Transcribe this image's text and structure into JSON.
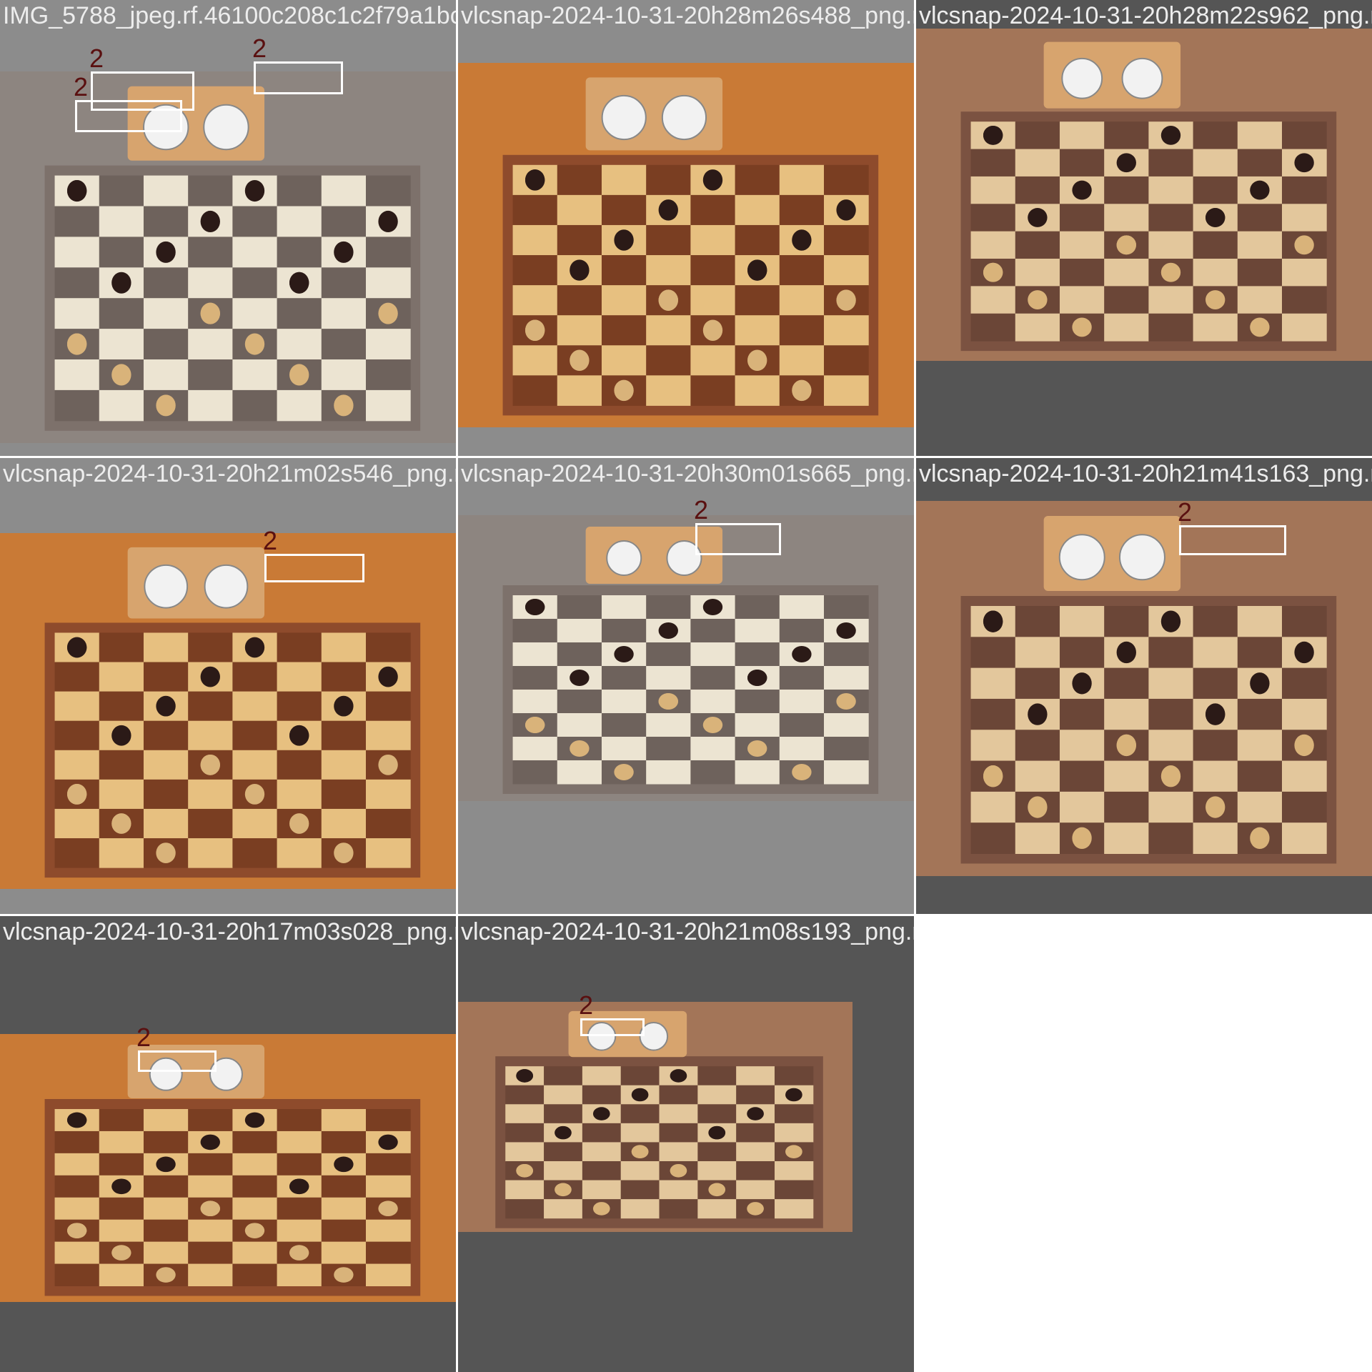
{
  "colors": {
    "background": "#ffffff",
    "pad_light": "#8c8c8c",
    "pad_dark": "#555555",
    "caption": "#ededed",
    "bbox": "#ffffff",
    "bbox_label": "#5a1010"
  },
  "tiles": [
    {
      "filename": "IMG_5788_jpeg.rf.46100c208c1c2f79a1bcdd83",
      "label": "2",
      "pad": "light",
      "theme": "grey-wood",
      "icon": "chessboard-clock-photo"
    },
    {
      "filename": "vlcsnap-2024-10-31-20h28m26s488_png.rf.b",
      "label": "2",
      "pad": "light",
      "theme": "orange-wood",
      "icon": "chessboard-clock-photo"
    },
    {
      "filename": "vlcsnap-2024-10-31-20h28m22s962_png.rf.",
      "label": "2",
      "pad": "dark",
      "theme": "brown-wood",
      "icon": "chessboard-clock-photo"
    },
    {
      "filename": "vlcsnap-2024-10-31-20h21m02s546_png.rf.a",
      "label": "2",
      "pad": "light",
      "theme": "orange-wood",
      "icon": "chessboard-clock-photo"
    },
    {
      "filename": "vlcsnap-2024-10-31-20h30m01s665_png.rf.b",
      "label": "2",
      "pad": "light",
      "theme": "grey-wood",
      "icon": "chessboard-clock-photo"
    },
    {
      "filename": "vlcsnap-2024-10-31-20h21m41s163_png.rf.",
      "label": "2",
      "pad": "dark",
      "theme": "brown-wood",
      "icon": "chessboard-clock-photo"
    },
    {
      "filename": "vlcsnap-2024-10-31-20h17m03s028_png.rf.3",
      "label": "2",
      "pad": "dark",
      "theme": "orange-wood",
      "icon": "chessboard-clock-photo"
    },
    {
      "filename": "vlcsnap-2024-10-31-20h21m08s193_png.rf.3",
      "label": "2",
      "pad": "dark",
      "theme": "brown-wood",
      "icon": "chessboard-clock-photo"
    }
  ]
}
